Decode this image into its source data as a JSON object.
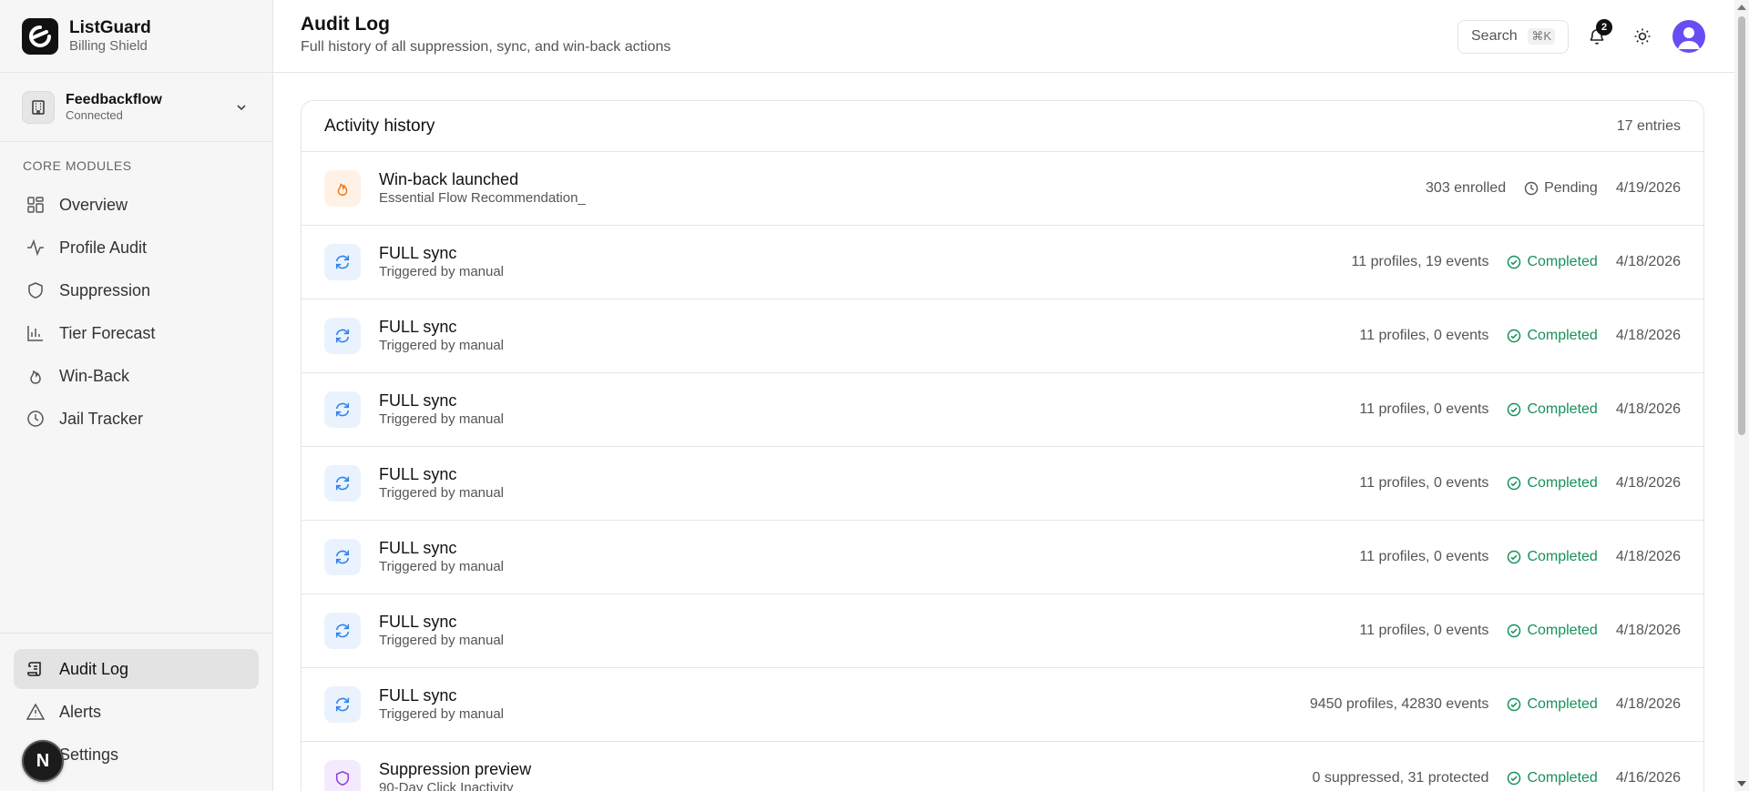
{
  "brand": {
    "name": "ListGuard",
    "subtitle": "Billing Shield"
  },
  "workspace": {
    "name": "Feedbackflow",
    "status": "Connected"
  },
  "sidebar": {
    "section_label": "CORE MODULES",
    "items": [
      {
        "label": "Overview",
        "icon": "grid-icon"
      },
      {
        "label": "Profile Audit",
        "icon": "activity-icon"
      },
      {
        "label": "Suppression",
        "icon": "shield-icon"
      },
      {
        "label": "Tier Forecast",
        "icon": "bar-chart-icon"
      },
      {
        "label": "Win-Back",
        "icon": "flame-icon"
      },
      {
        "label": "Jail Tracker",
        "icon": "clock-icon"
      }
    ],
    "bottom_items": [
      {
        "label": "Audit Log",
        "icon": "scroll-icon",
        "active": true
      },
      {
        "label": "Alerts",
        "icon": "alert-triangle-icon"
      },
      {
        "label": "Settings",
        "icon": "gear-icon"
      }
    ],
    "n_badge": "N"
  },
  "header": {
    "title": "Audit Log",
    "subtitle": "Full history of all suppression, sync, and win-back actions",
    "search_label": "Search",
    "search_shortcut": "⌘K",
    "notification_count": "2"
  },
  "activity": {
    "title": "Activity history",
    "entry_count": "17 entries",
    "rows": [
      {
        "type": "winback",
        "title": "Win-back launched",
        "subtitle": "Essential Flow Recommendation_",
        "detail": "303 enrolled",
        "status": "Pending",
        "date": "4/19/2026"
      },
      {
        "type": "sync",
        "title": "FULL sync",
        "subtitle": "Triggered by manual",
        "detail": "11 profiles, 19 events",
        "status": "Completed",
        "date": "4/18/2026"
      },
      {
        "type": "sync",
        "title": "FULL sync",
        "subtitle": "Triggered by manual",
        "detail": "11 profiles, 0 events",
        "status": "Completed",
        "date": "4/18/2026"
      },
      {
        "type": "sync",
        "title": "FULL sync",
        "subtitle": "Triggered by manual",
        "detail": "11 profiles, 0 events",
        "status": "Completed",
        "date": "4/18/2026"
      },
      {
        "type": "sync",
        "title": "FULL sync",
        "subtitle": "Triggered by manual",
        "detail": "11 profiles, 0 events",
        "status": "Completed",
        "date": "4/18/2026"
      },
      {
        "type": "sync",
        "title": "FULL sync",
        "subtitle": "Triggered by manual",
        "detail": "11 profiles, 0 events",
        "status": "Completed",
        "date": "4/18/2026"
      },
      {
        "type": "sync",
        "title": "FULL sync",
        "subtitle": "Triggered by manual",
        "detail": "11 profiles, 0 events",
        "status": "Completed",
        "date": "4/18/2026"
      },
      {
        "type": "sync",
        "title": "FULL sync",
        "subtitle": "Triggered by manual",
        "detail": "9450 profiles, 42830 events",
        "status": "Completed",
        "date": "4/18/2026"
      },
      {
        "type": "suppression",
        "title": "Suppression preview",
        "subtitle": "90-Day Click Inactivity",
        "detail": "0 suppressed, 31 protected",
        "status": "Completed",
        "date": "4/16/2026"
      }
    ]
  },
  "colors": {
    "completed": "#16915a",
    "winback_icon": "#f07a1a",
    "sync_icon": "#2f80ed",
    "suppression_icon": "#8b3fd9",
    "avatar": "#6a4cf5"
  }
}
